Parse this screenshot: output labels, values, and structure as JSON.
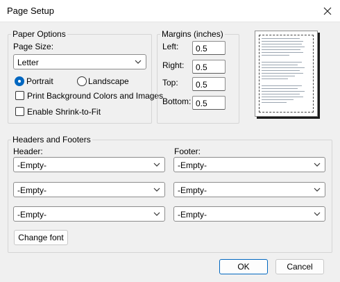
{
  "window": {
    "title": "Page Setup"
  },
  "paper_options": {
    "legend": "Paper Options",
    "page_size_label": "Page Size:",
    "page_size_value": "Letter",
    "portrait_label": "Portrait",
    "landscape_label": "Landscape",
    "orientation_selected": "Portrait",
    "print_bg_label": "Print Background Colors and Images",
    "print_bg_checked": false,
    "shrink_label": "Enable Shrink-to-Fit",
    "shrink_checked": false
  },
  "margins": {
    "legend": "Margins (inches)",
    "left_label": "Left:",
    "left_value": "0.5",
    "right_label": "Right:",
    "right_value": "0.5",
    "top_label": "Top:",
    "top_value": "0.5",
    "bottom_label": "Bottom:",
    "bottom_value": "0.5"
  },
  "headers_footers": {
    "legend": "Headers and Footers",
    "header_label": "Header:",
    "footer_label": "Footer:",
    "header_values": [
      "-Empty-",
      "-Empty-",
      "-Empty-"
    ],
    "footer_values": [
      "-Empty-",
      "-Empty-",
      "-Empty-"
    ],
    "change_font_label": "Change font"
  },
  "buttons": {
    "ok_label": "OK",
    "cancel_label": "Cancel"
  },
  "colors": {
    "accent": "#0067c0",
    "background": "#f0f0f0"
  },
  "icons": {
    "close": "close-icon",
    "dropdown": "chevron-down-icon"
  }
}
